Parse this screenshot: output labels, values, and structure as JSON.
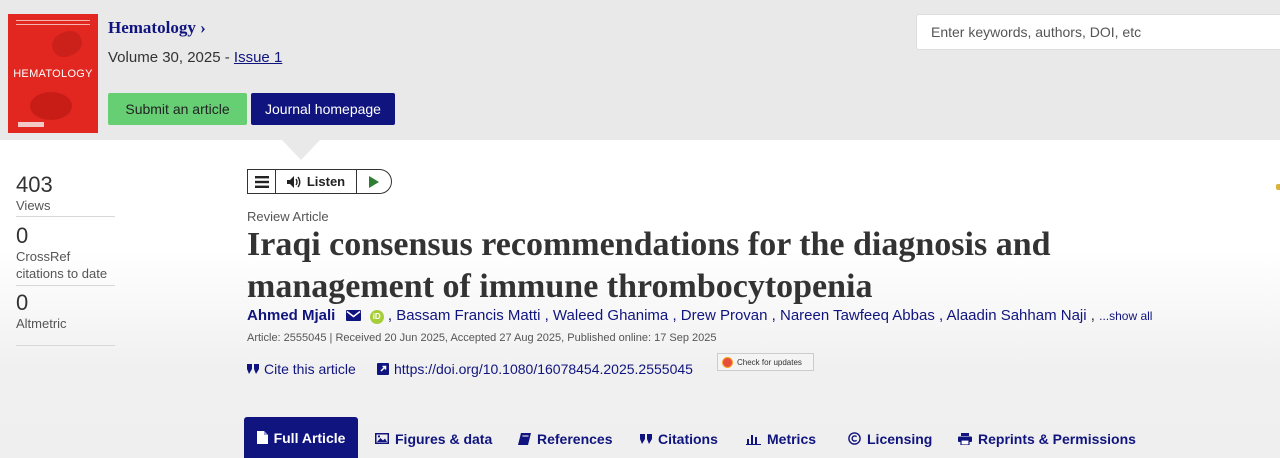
{
  "journal": {
    "name": "Hematology",
    "chevron": "›",
    "cover_title": "HEMATOLOGY",
    "volume_text": "Volume 30, 2025 - ",
    "issue_link": "Issue 1"
  },
  "header": {
    "submit_label": "Submit an article",
    "homepage_label": "Journal homepage",
    "search_placeholder": "Enter keywords, authors, DOI, etc"
  },
  "metrics": [
    {
      "value": "403",
      "label": "Views"
    },
    {
      "value": "0",
      "label": "CrossRef citations to date"
    },
    {
      "value": "0",
      "label": "Altmetric"
    }
  ],
  "listen": {
    "label": "Listen"
  },
  "article": {
    "type": "Review Article",
    "title": "Iraqi consensus recommendations for the diagnosis and management of immune thrombocytopenia",
    "first_author": "Ahmed Mjali",
    "orcid": "iD",
    "authors": [
      ", Bassam Francis Matti",
      ", Waleed Ghanima",
      ", Drew Provan",
      ", Nareen Tawfeeq Abbas",
      ", Alaadin Sahham Naji",
      ","
    ],
    "show_all": "...show all",
    "meta": "Article: 2555045 | Received 20 Jun 2025, Accepted 27 Aug 2025, Published online: 17 Sep 2025",
    "cite_label": "Cite this article",
    "doi": "https://doi.org/10.1080/16078454.2025.2555045",
    "check_updates": "Check for updates"
  },
  "tabs": [
    {
      "label": "Full Article",
      "icon": "document-icon"
    },
    {
      "label": "Figures & data",
      "icon": "image-icon"
    },
    {
      "label": "References",
      "icon": "book-icon"
    },
    {
      "label": "Citations",
      "icon": "quote-icon"
    },
    {
      "label": "Metrics",
      "icon": "bar-chart-icon"
    },
    {
      "label": "Licensing",
      "icon": "copyright-icon"
    },
    {
      "label": "Reprints & Permissions",
      "icon": "printer-icon"
    }
  ],
  "colors": {
    "brand_navy": "#10147e",
    "submit_green": "#66cf74",
    "cover_red": "#e1271f"
  }
}
